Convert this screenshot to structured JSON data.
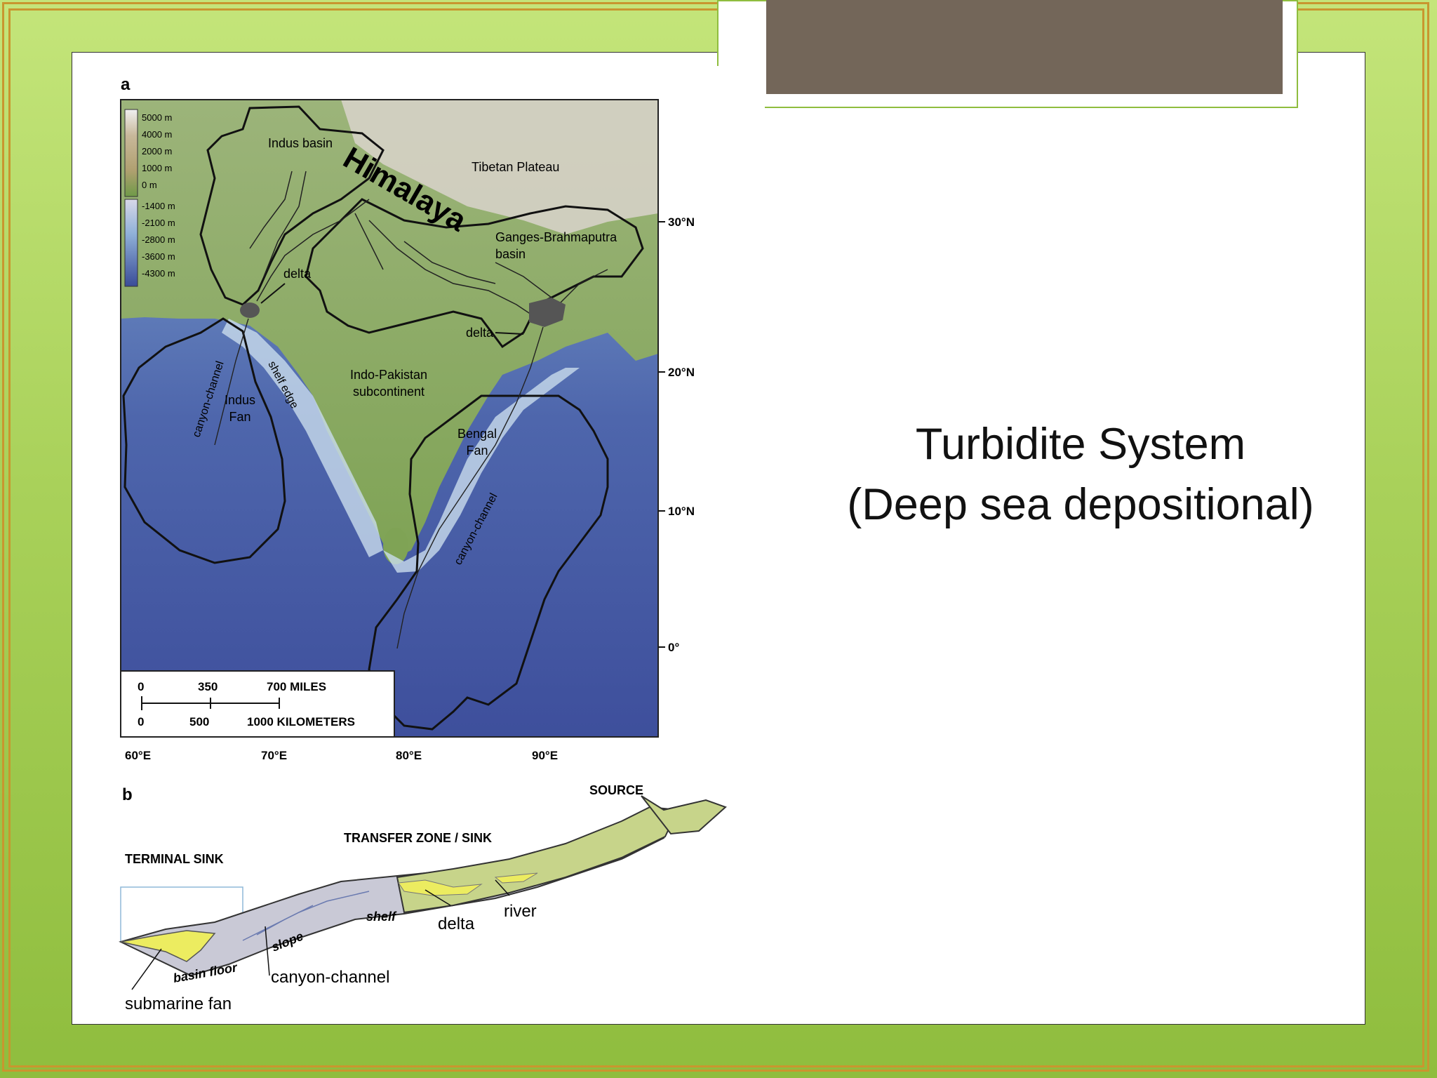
{
  "slide": {
    "title_lines": [
      "Turbidite System",
      "(Deep sea depositional)"
    ]
  },
  "panel_a": {
    "label": "a",
    "legend_land": [
      "5000 m",
      "4000 m",
      "2000 m",
      "1000 m",
      "0 m"
    ],
    "legend_sea": [
      "-1400 m",
      "-2100 m",
      "-2800 m",
      "-3600 m",
      "-4300 m"
    ],
    "lat_labels": [
      "30°N",
      "20°N",
      "10°N",
      "0°"
    ],
    "lon_labels": [
      "60°E",
      "70°E",
      "80°E",
      "90°E"
    ],
    "regions": {
      "indus_basin": "Indus basin",
      "himalaya": "Himalaya",
      "tibetan_plateau": "Tibetan Plateau",
      "ganges_line1": "Ganges-Brahmaputra",
      "ganges_line2": "basin",
      "delta_indus": "delta",
      "delta_ganges": "delta",
      "indo_line1": "Indo-Pakistan",
      "indo_line2": "subcontinent",
      "indus_fan_line1": "Indus",
      "indus_fan_line2": "Fan",
      "bengal_fan_line1": "Bengal",
      "bengal_fan_line2": "Fan",
      "canyon_channel_indus": "canyon-channel",
      "canyon_channel_bengal": "canyon-channel",
      "shelf_edge": "shelf edge"
    },
    "scale": {
      "miles_ticks": [
        "0",
        "350",
        "700 MILES"
      ],
      "km_ticks": [
        "0",
        "500",
        "1000 KILOMETERS"
      ]
    }
  },
  "panel_b": {
    "label": "b",
    "source": "SOURCE",
    "transfer_zone": "TRANSFER ZONE / SINK",
    "terminal_sink": "TERMINAL SINK",
    "shelf": "shelf",
    "slope": "slope",
    "basin_floor": "basin floor",
    "delta": "delta",
    "river": "river",
    "canyon_channel": "canyon-channel",
    "submarine_fan": "submarine fan"
  },
  "colors": {
    "background": "#a9d15a",
    "frame": "#c9962f",
    "title_bar": "#736659",
    "land": "#8fae5a",
    "deep_sea": "#4a5fa8",
    "shelf_sea": "#8fb8d8",
    "highlight": "#e8e85a"
  }
}
